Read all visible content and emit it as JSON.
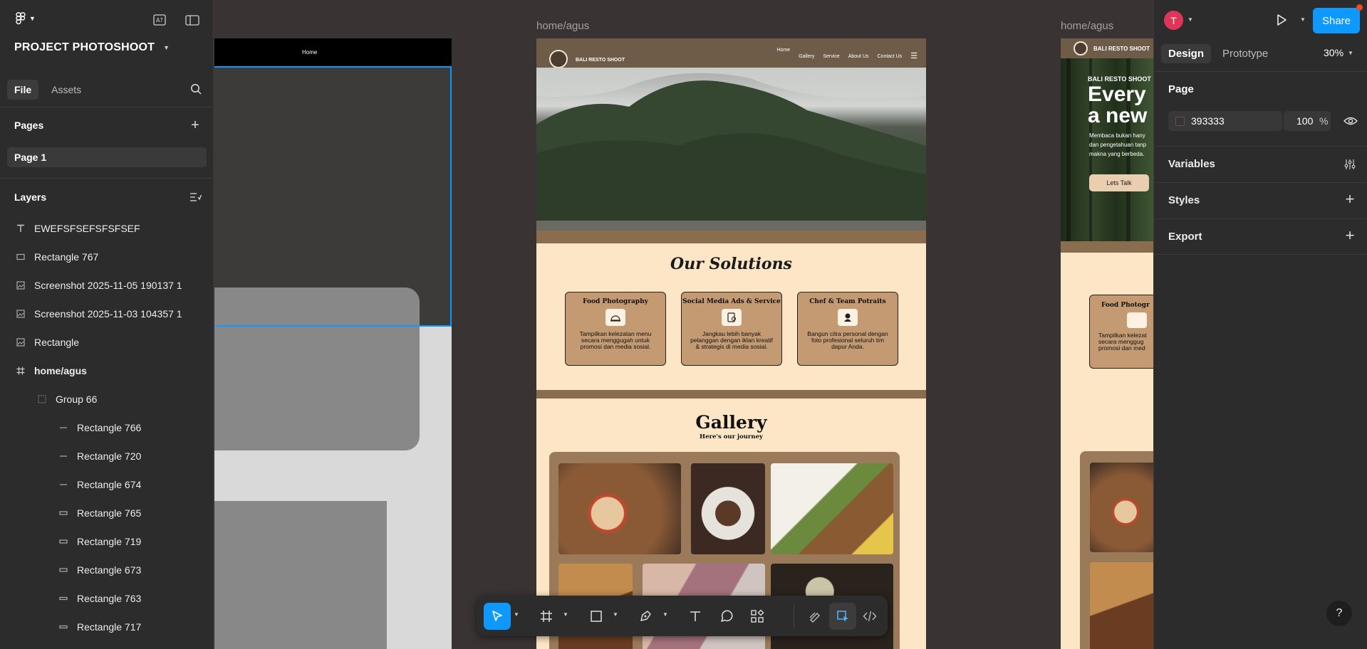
{
  "project": {
    "name": "PROJECT PHOTOSHOOT"
  },
  "left_panel": {
    "tabs": [
      "File",
      "Assets"
    ],
    "pages_title": "Pages",
    "pages": [
      "Page 1"
    ],
    "layers_title": "Layers",
    "layers": [
      {
        "name": "EWEFSFSEFSFSFSEF",
        "icon": "text-icon"
      },
      {
        "name": "Rectangle 767",
        "icon": "rectangle-icon"
      },
      {
        "name": "Screenshot 2025-11-05 190137 1",
        "icon": "image-icon"
      },
      {
        "name": "Screenshot 2025-11-03 104357 1",
        "icon": "image-icon"
      },
      {
        "name": "Rectangle",
        "icon": "image-icon"
      },
      {
        "name": "home/agus",
        "icon": "frame-icon"
      },
      {
        "name": "Group 66",
        "icon": "group-icon"
      },
      {
        "name": "Rectangle 766",
        "icon": "line-rect-icon"
      },
      {
        "name": "Rectangle 720",
        "icon": "line-rect-icon"
      },
      {
        "name": "Rectangle 674",
        "icon": "line-rect-icon"
      },
      {
        "name": "Rectangle 765",
        "icon": "rectangle-icon"
      },
      {
        "name": "Rectangle 719",
        "icon": "rectangle-icon"
      },
      {
        "name": "Rectangle 673",
        "icon": "rectangle-icon"
      },
      {
        "name": "Rectangle 763",
        "icon": "rectangle-icon"
      },
      {
        "name": "Rectangle 717",
        "icon": "rectangle-icon"
      }
    ]
  },
  "canvas": {
    "frame_label_main": "home/agus",
    "frame_label_right": "home/agus",
    "left_frame_nav": "Home",
    "site": {
      "brand": "BALI RESTO SHOOT",
      "nav_links": [
        "Home",
        "Gallery",
        "Service",
        "About Us",
        "Contact Us"
      ],
      "solutions_title": "Our Solutions",
      "cards": [
        {
          "title": "Food Photography",
          "desc": "Tampilkan kelezatan menu secara menggugah untuk promosi dan media sosial."
        },
        {
          "title": "Social Media Ads & Service",
          "desc": "Jangkau lebih banyak pelanggan dengan iklan kreatif & strategis di media sosial."
        },
        {
          "title": "Chef & Team Potraits",
          "desc": "Bangun citra personal dengan foto profesional seluruh tim dapur Anda."
        }
      ],
      "gallery_title": "Gallery",
      "gallery_subtitle": "Here's our journey"
    },
    "right_frame": {
      "brand": "BALI RESTO SHOOT",
      "headline_1": "Every p",
      "headline_2": "a new",
      "body": "Membaca bukan hany dan pengetahuan tanp makna yang berbeda.",
      "cta": "Lets Talk",
      "card_title": "Food Photogr",
      "card_desc": "Tampilkan kelezat secara menggug promosi dan med"
    }
  },
  "right_panel": {
    "avatar_initial": "T",
    "share_label": "Share",
    "tabs": [
      "Design",
      "Prototype"
    ],
    "zoom": "30%",
    "page_section": "Page",
    "page_color_hex": "393333",
    "page_opacity": "100",
    "percent_symbol": "%",
    "sections": [
      "Variables",
      "Styles",
      "Export"
    ],
    "help": "?"
  },
  "colors": {
    "accent": "#0d99ff",
    "canvas_bg": "#393333",
    "panel_bg": "#2c2c2c",
    "site_cream": "#fde6c6",
    "site_brown": "#8a6d4f",
    "card_tan": "#c49a73"
  }
}
